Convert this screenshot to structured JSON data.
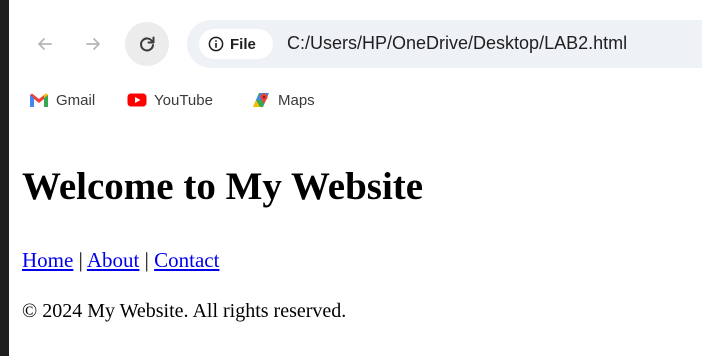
{
  "browser": {
    "nav": {
      "back_icon": "arrow-left-icon",
      "forward_icon": "arrow-right-icon",
      "reload_icon": "reload-icon"
    },
    "address_bar": {
      "chip_icon": "info-icon",
      "chip_label": "File",
      "url": "C:/Users/HP/OneDrive/Desktop/LAB2.html"
    },
    "bookmarks": [
      {
        "label": "Gmail",
        "icon": "gmail-icon"
      },
      {
        "label": "YouTube",
        "icon": "youtube-icon"
      },
      {
        "label": "Maps",
        "icon": "maps-icon"
      }
    ]
  },
  "page": {
    "title": "Welcome to My Website",
    "nav_links": [
      {
        "label": "Home"
      },
      {
        "label": "About"
      },
      {
        "label": "Contact"
      }
    ],
    "separator": "|",
    "footer": "© 2024 My Website. All rights reserved."
  },
  "colors": {
    "link": "#0000ee",
    "omnibox_bg": "#eef1f6",
    "youtube_red": "#ff0000"
  }
}
